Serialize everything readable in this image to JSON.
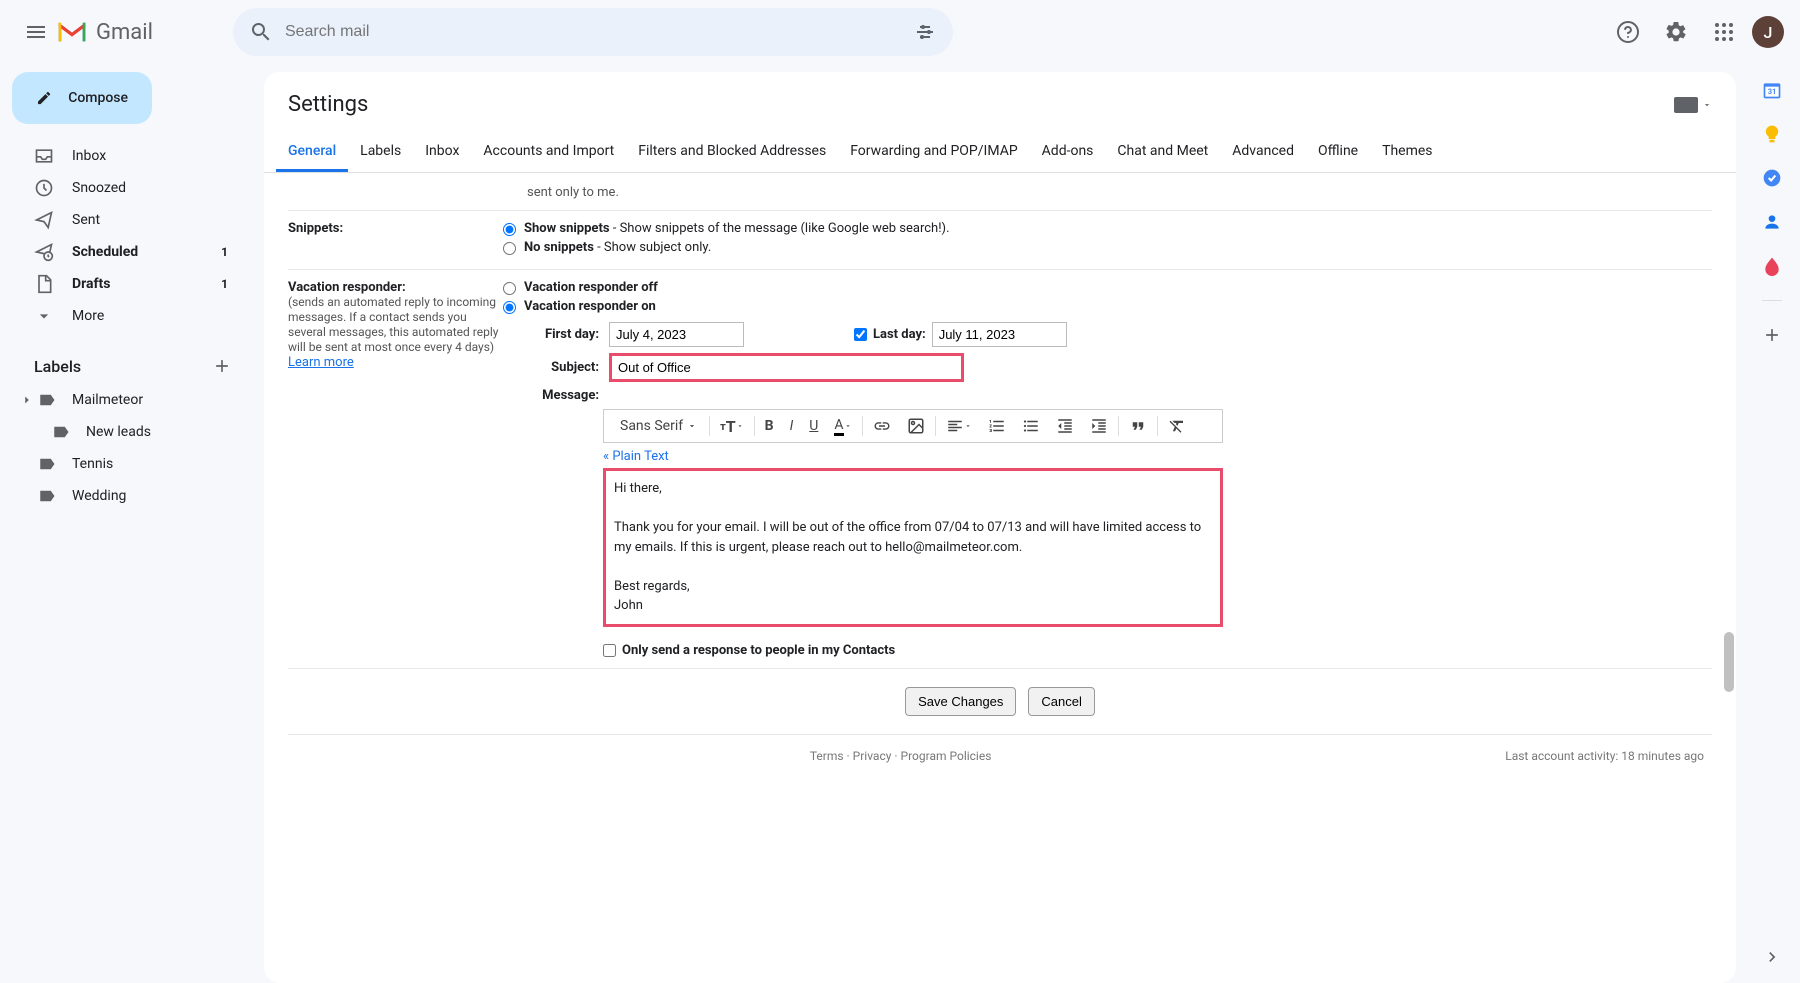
{
  "header": {
    "brand": "Gmail",
    "search_placeholder": "Search mail",
    "avatar_initial": "J"
  },
  "sidebar": {
    "compose": "Compose",
    "items": [
      {
        "label": "Inbox",
        "count": ""
      },
      {
        "label": "Snoozed",
        "count": ""
      },
      {
        "label": "Sent",
        "count": ""
      },
      {
        "label": "Scheduled",
        "count": "1"
      },
      {
        "label": "Drafts",
        "count": "1"
      },
      {
        "label": "More",
        "count": ""
      }
    ],
    "labels_title": "Labels",
    "labels": [
      {
        "label": "Mailmeteor"
      },
      {
        "label": "New leads"
      },
      {
        "label": "Tennis"
      },
      {
        "label": "Wedding"
      }
    ]
  },
  "settings": {
    "title": "Settings",
    "tabs": [
      "General",
      "Labels",
      "Inbox",
      "Accounts and Import",
      "Filters and Blocked Addresses",
      "Forwarding and POP/IMAP",
      "Add-ons",
      "Chat and Meet",
      "Advanced",
      "Offline",
      "Themes"
    ],
    "truncated_line": "sent only to me.",
    "snippets": {
      "label": "Snippets:",
      "show_bold": "Show snippets",
      "show_rest": " - Show snippets of the message (like Google web search!).",
      "no_bold": "No snippets",
      "no_rest": " - Show subject only."
    },
    "vacation": {
      "label": "Vacation responder:",
      "sub": "(sends an automated reply to incoming messages. If a contact sends you several messages, this automated reply will be sent at most once every 4 days)",
      "learn_more": "Learn more",
      "off": "Vacation responder off",
      "on": "Vacation responder on",
      "first_day_label": "First day:",
      "first_day_value": "July 4, 2023",
      "last_day_label": "Last day:",
      "last_day_value": "July 11, 2023",
      "subject_label": "Subject:",
      "subject_value": "Out of Office",
      "message_label": "Message:",
      "font_name": "Sans Serif",
      "plain_text": "« Plain Text",
      "message_body": "Hi there,\n\nThank you for your email. I will be out of the office from 07/04 to 07/13 and will have limited access to my emails. If this is urgent, please reach out to hello@mailmeteor.com.\n\nBest regards,\nJohn",
      "contacts_only": "Only send a response to people in my Contacts"
    },
    "save": "Save Changes",
    "cancel": "Cancel"
  },
  "footer": {
    "terms": "Terms",
    "privacy": "Privacy",
    "policies": "Program Policies",
    "activity": "Last account activity: 18 minutes ago"
  }
}
